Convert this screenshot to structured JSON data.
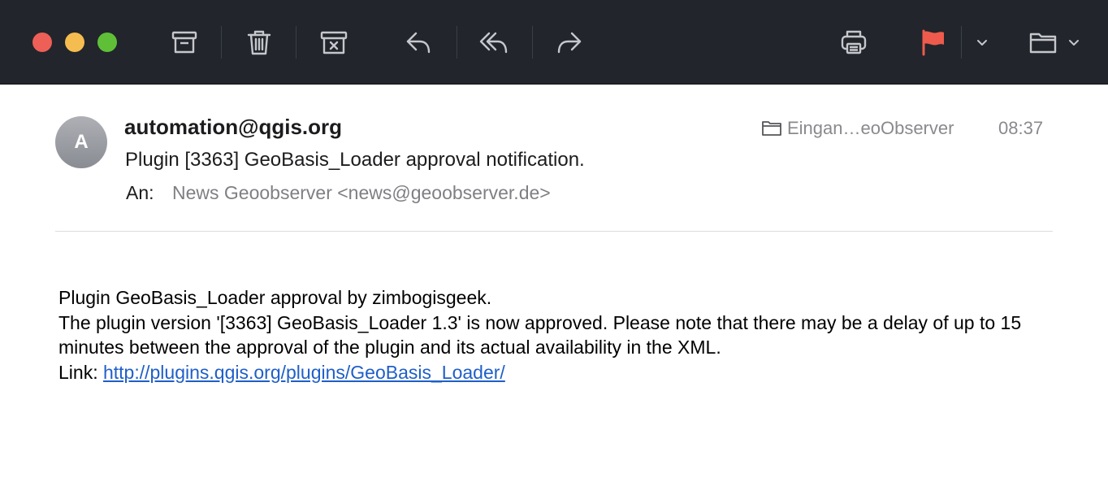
{
  "window": {
    "traffic_lights": {
      "close_color": "#ee5f57",
      "minimize_color": "#f5bd4f",
      "maximize_color": "#5fc038"
    }
  },
  "toolbar": {
    "icons": [
      "archive-icon",
      "trash-icon",
      "junk-icon",
      "reply-icon",
      "reply-all-icon",
      "forward-icon",
      "print-icon",
      "flag-icon",
      "chevron-down-icon",
      "folder-icon",
      "chevron-down-icon"
    ],
    "flag_color": "#ee5b4c",
    "background": "#22252b"
  },
  "message": {
    "avatar_initial": "A",
    "sender": "automation@qgis.org",
    "subject": "Plugin [3363] GeoBasis_Loader approval notification.",
    "to_label": "An:",
    "to_value": "News Geoobserver <news@geoobserver.de>",
    "mailbox": "Eingan…eoObserver",
    "time": "08:37",
    "body": {
      "line1": "Plugin GeoBasis_Loader approval by zimbogisgeek.",
      "line2": "The plugin version '[3363] GeoBasis_Loader 1.3' is now approved. Please note that there may be a delay of up to 15 minutes between the approval of the plugin and its actual availability in the XML.",
      "link_label": "Link: ",
      "link_url": "http://plugins.qgis.org/plugins/GeoBasis_Loader/"
    },
    "link_color": "#1f5fc8"
  }
}
